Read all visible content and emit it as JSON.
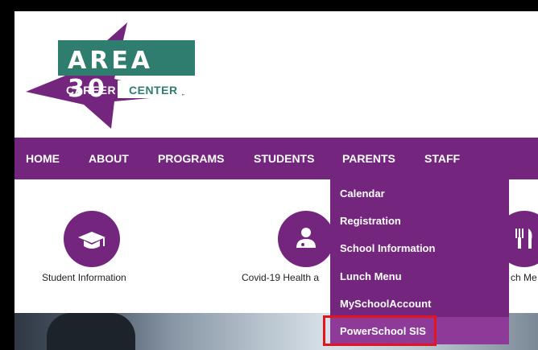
{
  "logo": {
    "title": "AREA 30",
    "subtitle_left": "CAREER",
    "subtitle_right": "CENTER",
    "colors": {
      "teal": "#2f7d6e",
      "purple": "#74267f"
    }
  },
  "nav": {
    "items": [
      {
        "label": "HOME"
      },
      {
        "label": "ABOUT"
      },
      {
        "label": "PROGRAMS"
      },
      {
        "label": "STUDENTS"
      },
      {
        "label": "PARENTS"
      },
      {
        "label": "STAFF"
      }
    ]
  },
  "dropdown": {
    "parent": "PARENTS",
    "items": [
      {
        "label": "Calendar"
      },
      {
        "label": "Registration"
      },
      {
        "label": "School Information"
      },
      {
        "label": "Lunch Menu"
      },
      {
        "label": "MySchoolAccount"
      },
      {
        "label": "PowerSchool SIS",
        "highlighted": true
      }
    ]
  },
  "quicklinks": [
    {
      "label": "Student Information",
      "icon": "graduation-cap-icon"
    },
    {
      "label": "Covid-19 Health a",
      "icon": "doctor-icon"
    },
    {
      "label": "ch Me",
      "icon": "fork-knife-icon"
    }
  ],
  "theme": {
    "purple": "#74267f",
    "highlight": "#8d3a99",
    "annotation_red": "#e5141d"
  }
}
